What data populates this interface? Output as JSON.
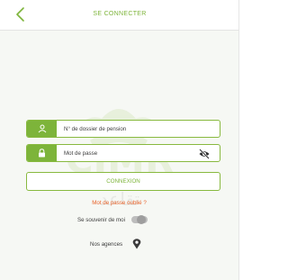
{
  "header": {
    "title": "SE CONNECTER",
    "back_icon": "chevron-left-icon"
  },
  "form": {
    "pension_field": {
      "placeholder": "N° de dossier de pension",
      "icon": "user-icon"
    },
    "password_field": {
      "placeholder": "Mot de passe",
      "icon": "lock-icon",
      "toggle_icon": "eye-slash-icon"
    },
    "submit_label": "CONNEXION",
    "forgot_password": "Mot de passe oublié ?",
    "remember_me": {
      "label": "Se souvenir de moi",
      "checked": false
    },
    "agencies": {
      "label": "Nos agences",
      "icon": "map-pin-icon"
    }
  },
  "watermark": {
    "brand": "CIMR",
    "arabic": "تقاعد"
  },
  "colors": {
    "accent": "#7db43a",
    "link": "#e8632b",
    "text": "#3d3d3d",
    "border": "#88b93f"
  }
}
